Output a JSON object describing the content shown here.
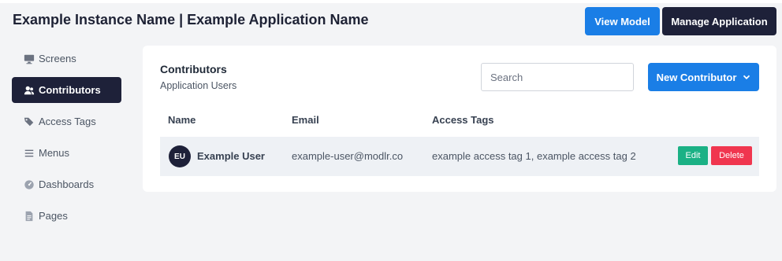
{
  "header": {
    "title": "Example Instance Name | Example Application Name",
    "view_model_label": "View Model",
    "manage_application_label": "Manage Application"
  },
  "sidebar": {
    "items": [
      {
        "label": "Screens",
        "icon": "monitor-icon",
        "active": false
      },
      {
        "label": "Contributors",
        "icon": "users-icon",
        "active": true
      },
      {
        "label": "Access Tags",
        "icon": "tags-icon",
        "active": false
      },
      {
        "label": "Menus",
        "icon": "menu-icon",
        "active": false
      },
      {
        "label": "Dashboards",
        "icon": "dashboard-icon",
        "active": false
      },
      {
        "label": "Pages",
        "icon": "page-icon",
        "active": false
      }
    ]
  },
  "main": {
    "title": "Contributors",
    "subtitle": "Application Users",
    "search_placeholder": "Search",
    "new_contributor_label": "New Contributor",
    "columns": [
      "Name",
      "Email",
      "Access Tags"
    ],
    "rows": [
      {
        "initials": "EU",
        "name": "Example User",
        "email": "example-user@modlr.co",
        "access_tags": "example access tag 1, example access tag 2",
        "edit_label": "Edit",
        "delete_label": "Delete"
      }
    ]
  },
  "colors": {
    "primary": "#1a7ee6",
    "dark": "#1e2139",
    "edit": "#1bb185",
    "delete": "#f0364f",
    "background": "#f3f4f6"
  }
}
